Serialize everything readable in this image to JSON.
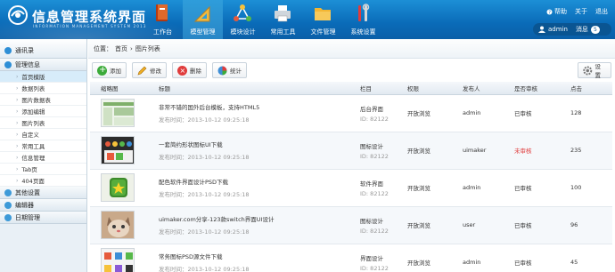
{
  "header": {
    "title": "信息管理系统界面",
    "subtitle": "INFORMATION MANAGEMENT SYSTEM 2013",
    "nav": [
      {
        "label": "工作台",
        "icon": "book-icon"
      },
      {
        "label": "模型管理",
        "icon": "ruler-icon"
      },
      {
        "label": "模块设计",
        "icon": "network-icon"
      },
      {
        "label": "常用工具",
        "icon": "printer-icon"
      },
      {
        "label": "文件管理",
        "icon": "folder-icon"
      },
      {
        "label": "系统设置",
        "icon": "tools-icon"
      }
    ],
    "active_nav": 1,
    "links": {
      "help": "帮助",
      "about": "关于",
      "logout": "退出"
    },
    "user": {
      "name": "admin",
      "messages_label": "消息",
      "messages_count": "5"
    }
  },
  "sidebar": {
    "top": "通讯录",
    "group1": "管理信息",
    "items": [
      "首页模版",
      "数据列表",
      "图片数据表",
      "添加编辑",
      "图片列表",
      "自定义",
      "常用工具",
      "信息管理",
      "Tab页",
      "404页面"
    ],
    "active_item": 0,
    "group2": "其他设置",
    "group3": "编辑器",
    "group4": "日期管理"
  },
  "main": {
    "breadcrumb": {
      "label": "位置：",
      "home": "首页",
      "sep": "›",
      "current": "图片列表"
    },
    "toolbar": {
      "add": "添加",
      "edit": "修改",
      "delete": "删除",
      "stats": "统计",
      "settings": "设置"
    },
    "columns": [
      "缩略图",
      "标题",
      "栏目",
      "权限",
      "发布人",
      "是否审核",
      "点击"
    ],
    "rows": [
      {
        "title": "非常不错的国外后台模板，支持HTML5",
        "time": "发布时间：2013-10-12 09:25:18",
        "column": "后台界面",
        "id": "ID: 82122",
        "perm": "开放浏览",
        "author": "admin",
        "status": "已审核",
        "status_ok": true,
        "clicks": "128"
      },
      {
        "title": "一套简约形状图标UI下载",
        "time": "发布时间：2013-10-12 09:25:18",
        "column": "图标设计",
        "id": "ID: 82122",
        "perm": "开放浏览",
        "author": "uimaker",
        "status": "未审核",
        "status_ok": false,
        "clicks": "235"
      },
      {
        "title": "配色软件界面设计PSD下载",
        "time": "发布时间：2013-10-12 09:25:18",
        "column": "软件界面",
        "id": "ID: 82122",
        "perm": "开放浏览",
        "author": "admin",
        "status": "已审核",
        "status_ok": true,
        "clicks": "100"
      },
      {
        "title": "uimaker.com分享-123款switch界面UI设计",
        "time": "发布时间：2013-10-12 09:25:18",
        "column": "图标设计",
        "id": "ID: 82122",
        "perm": "开放浏览",
        "author": "user",
        "status": "已审核",
        "status_ok": true,
        "clicks": "96"
      },
      {
        "title": "常务图标PSD源文件下载",
        "time": "发布时间：2013-10-12 09:25:18",
        "column": "界面设计",
        "id": "ID: 82122",
        "perm": "开放浏览",
        "author": "admin",
        "status": "已审核",
        "status_ok": true,
        "clicks": "45"
      }
    ]
  }
}
